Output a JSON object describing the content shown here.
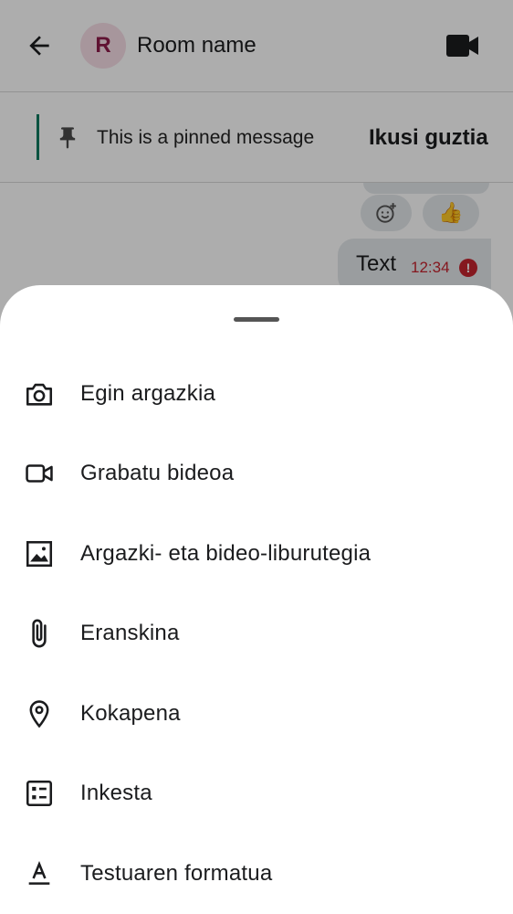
{
  "header": {
    "back_icon": "arrow-left-icon",
    "avatar_letter": "R",
    "room_name": "Room name",
    "video_icon": "video-camera-icon"
  },
  "pinned": {
    "icon": "pin-icon",
    "text": "This is a pinned message",
    "see_all": "Ikusi guztia"
  },
  "messages": {
    "reactions": {
      "add_icon": "add-reaction-icon",
      "thumb": "👍"
    },
    "last": {
      "text": "Text",
      "time": "12:34",
      "status_icon": "error-icon"
    }
  },
  "sheet": {
    "items": [
      {
        "label": "Egin argazkia",
        "icon": "camera-icon"
      },
      {
        "label": "Grabatu bideoa",
        "icon": "video-icon"
      },
      {
        "label": "Argazki- eta bideo-liburutegia",
        "icon": "image-icon"
      },
      {
        "label": "Eranskina",
        "icon": "paperclip-icon"
      },
      {
        "label": "Kokapena",
        "icon": "location-pin-icon"
      },
      {
        "label": "Inkesta",
        "icon": "poll-icon"
      },
      {
        "label": "Testuaren formatua",
        "icon": "text-format-icon"
      }
    ]
  },
  "colors": {
    "accent_pinned": "#0b7a5f",
    "error": "#c4242f",
    "avatar_bg": "#f6dde6",
    "avatar_text": "#8e1b4a"
  }
}
